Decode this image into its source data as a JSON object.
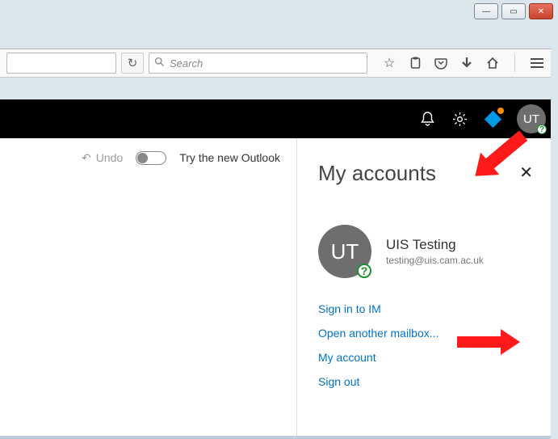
{
  "browser": {
    "search_placeholder": "Search"
  },
  "toolbar": {
    "undo_label": "Undo",
    "try_label": "Try the new Outlook"
  },
  "avatar_initials": "UT",
  "panel": {
    "title": "My accounts",
    "user_initials": "UT",
    "user_name": "UIS Testing",
    "user_email": "testing@uis.cam.ac.uk",
    "links": {
      "sign_in_im": "Sign in to IM",
      "open_mailbox": "Open another mailbox...",
      "my_account": "My account",
      "sign_out": "Sign out"
    }
  }
}
